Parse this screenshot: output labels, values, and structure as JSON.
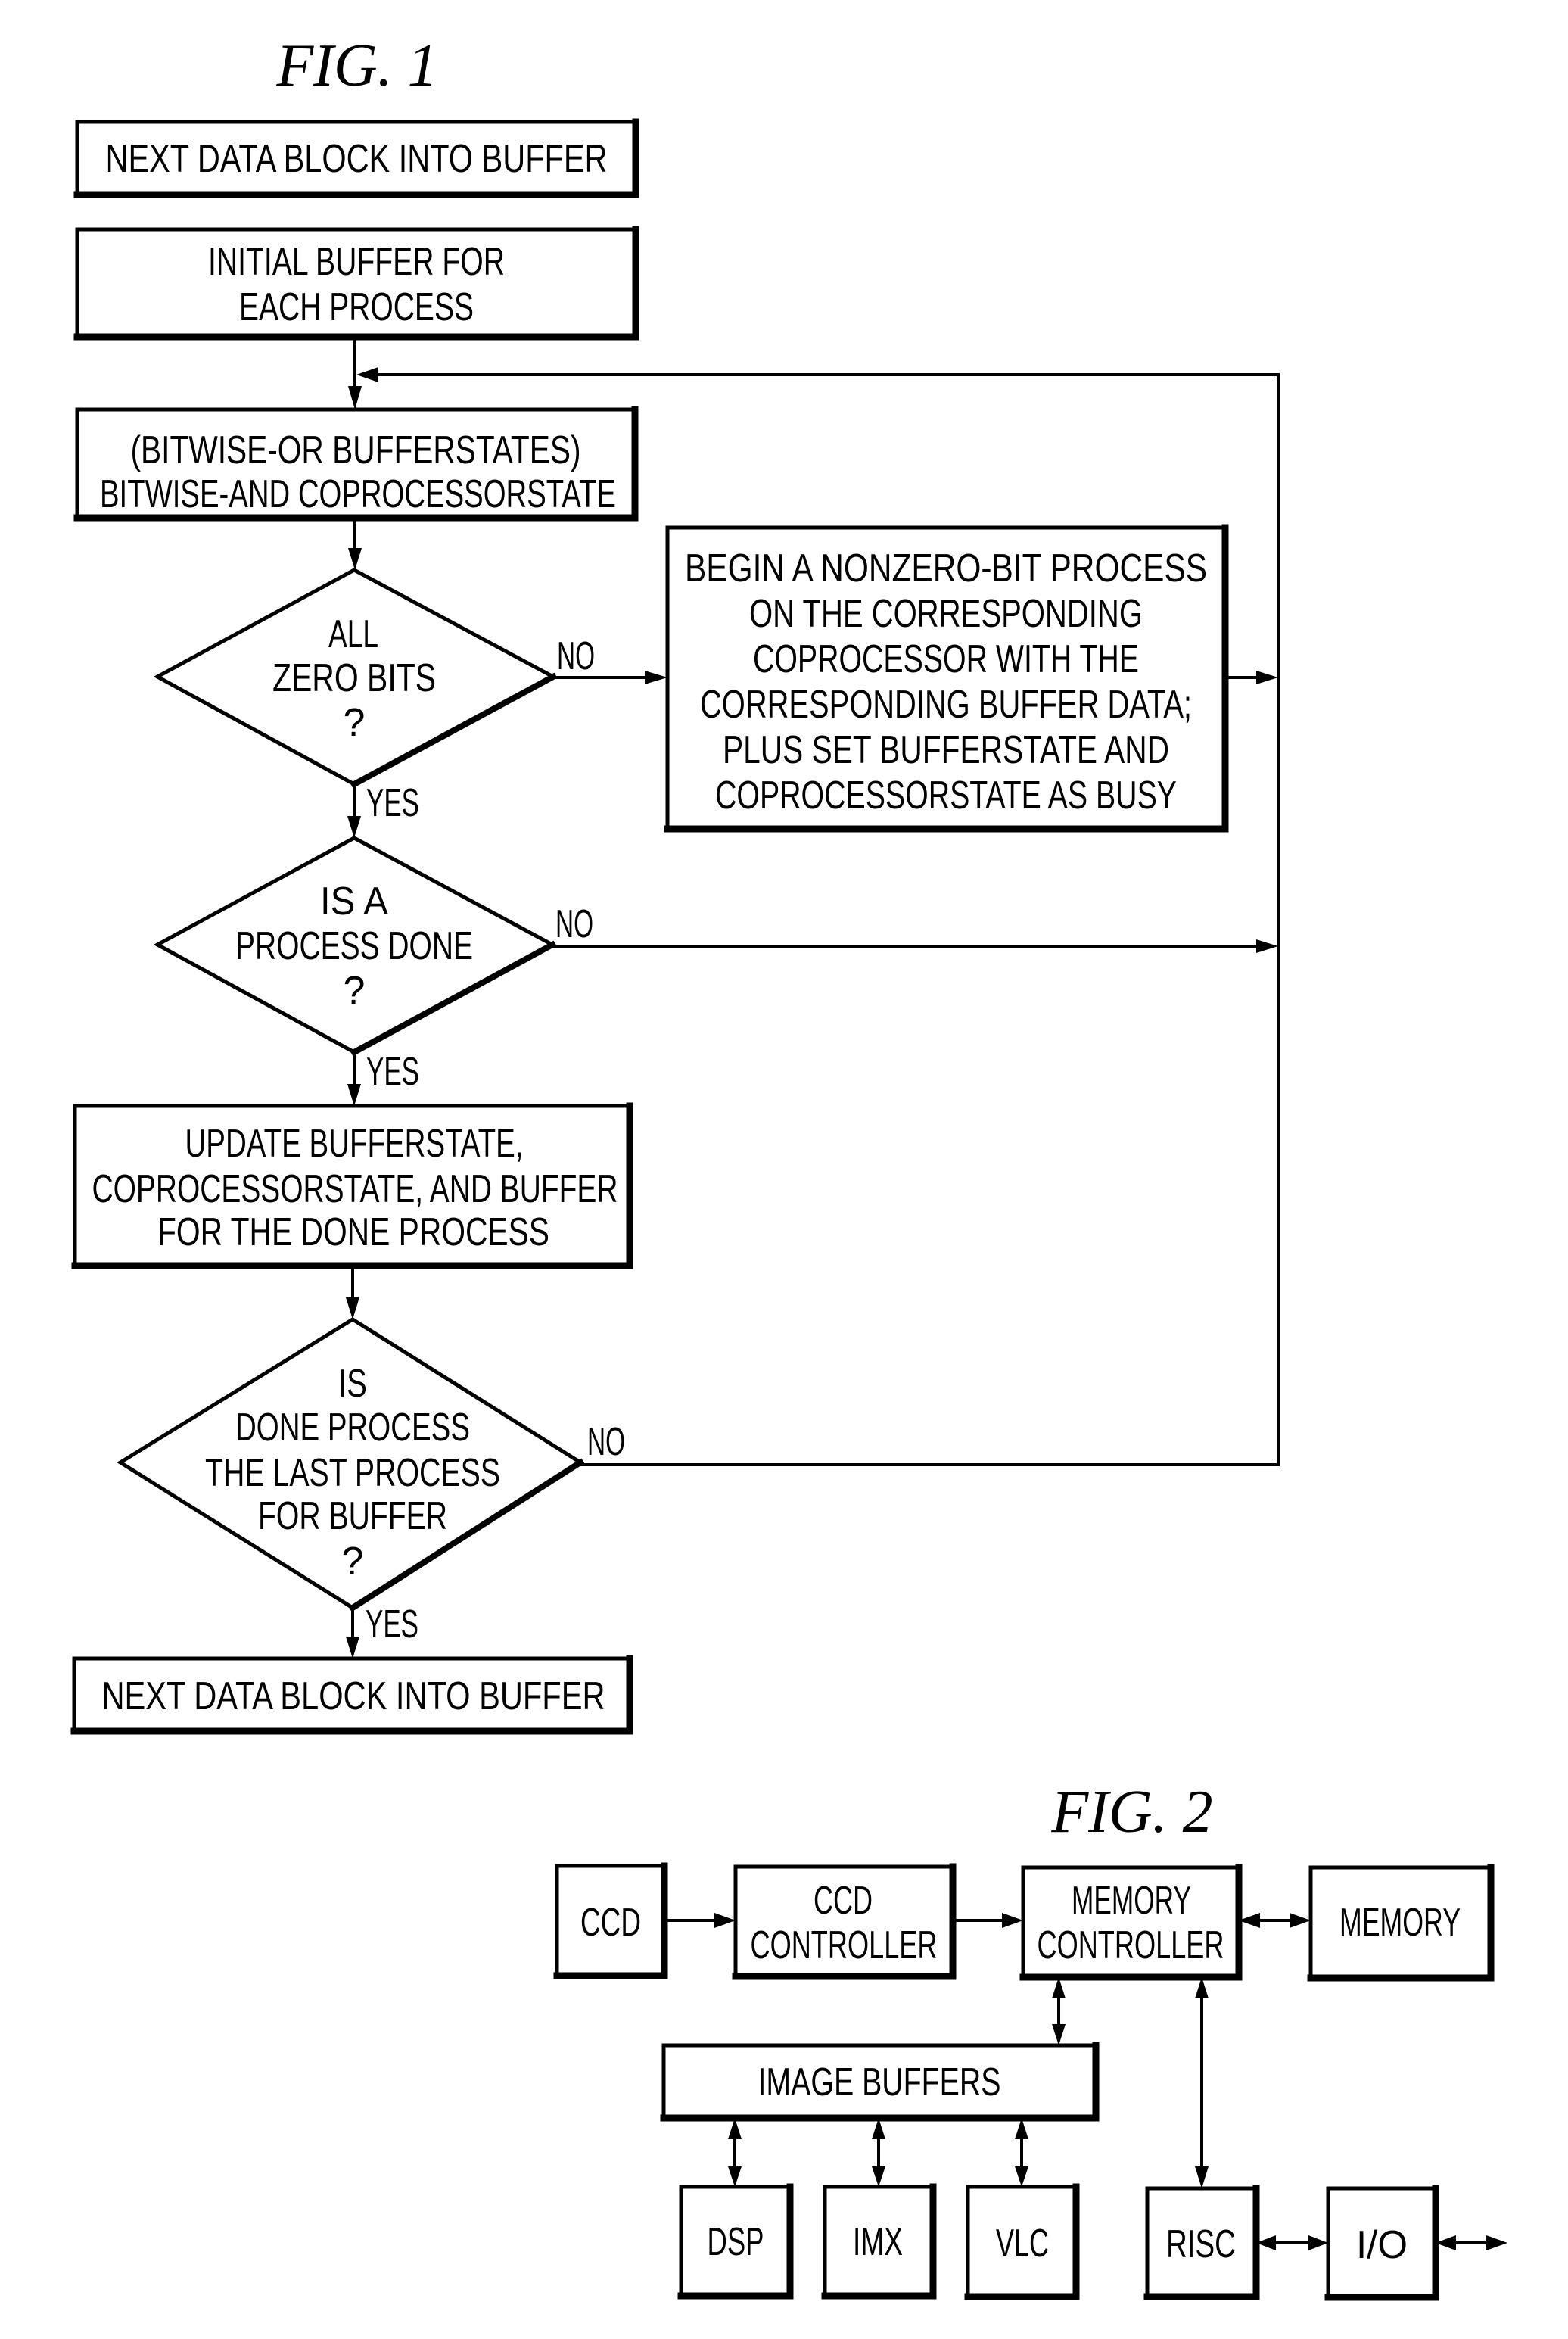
{
  "fig1": {
    "title": "FIG.  1",
    "start_box": "NEXT DATA BLOCK INTO BUFFER",
    "init_box": [
      "INITIAL BUFFER FOR",
      "EACH PROCESS"
    ],
    "bitwise_box": [
      "(BITWISE-OR BUFFERSTATES)",
      "BITWISE-AND COPROCESSORSTATE"
    ],
    "decision_zero_bits": [
      "ALL",
      "ZERO BITS",
      "?"
    ],
    "begin_process_box": [
      "BEGIN A NONZERO-BIT PROCESS",
      "ON THE CORRESPONDING",
      "COPROCESSOR WITH THE",
      "CORRESPONDING BUFFER DATA;",
      "PLUS SET BUFFERSTATE AND",
      "COPROCESSORSTATE AS BUSY"
    ],
    "decision_process_done": [
      "IS A",
      "PROCESS DONE",
      "?"
    ],
    "update_box": [
      "UPDATE BUFFERSTATE,",
      "COPROCESSORSTATE, AND BUFFER",
      "FOR THE DONE PROCESS"
    ],
    "decision_last_process": [
      "IS",
      "DONE PROCESS",
      "THE LAST PROCESS",
      "FOR BUFFER",
      "?"
    ],
    "end_box": "NEXT DATA BLOCK INTO BUFFER",
    "yes_label": "YES",
    "no_label": "NO"
  },
  "fig2": {
    "title": "FIG.  2",
    "ccd": "CCD",
    "ccd_controller": [
      "CCD",
      "CONTROLLER"
    ],
    "memory_controller": [
      "MEMORY",
      "CONTROLLER"
    ],
    "memory": "MEMORY",
    "image_buffers": "IMAGE BUFFERS",
    "dsp": "DSP",
    "imx": "IMX",
    "vlc": "VLC",
    "risc": "RISC",
    "io": "I/O"
  }
}
